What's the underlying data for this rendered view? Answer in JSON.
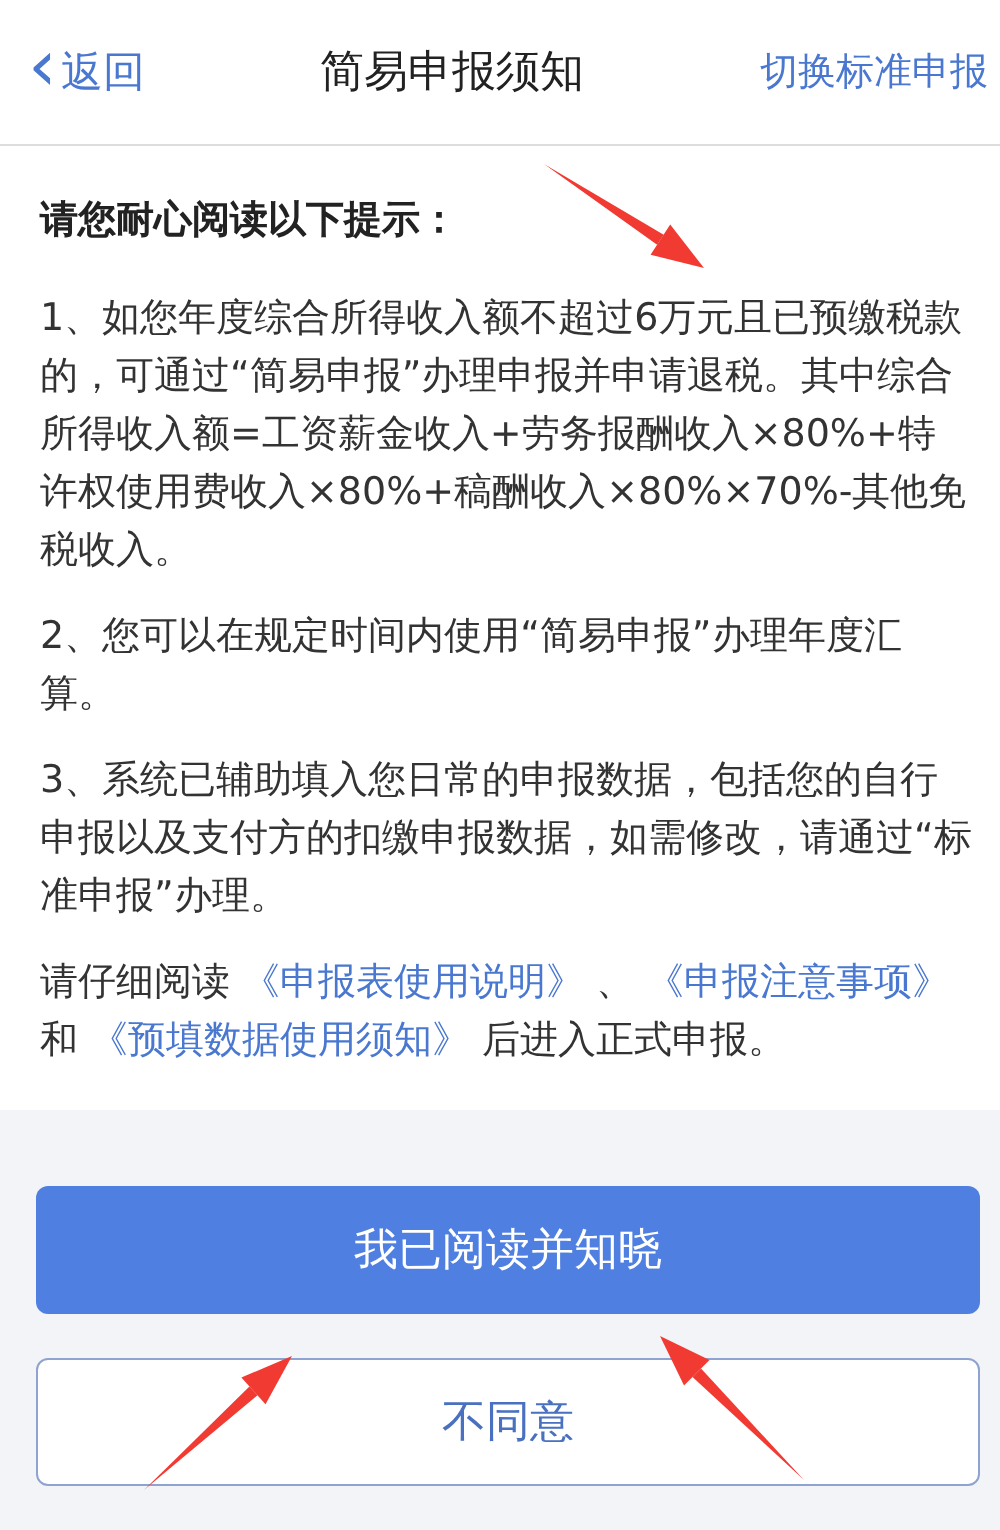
{
  "nav_bar": {
    "back": {
      "icon": "‹",
      "label": "返回"
    },
    "title": "简易申报须知",
    "action": "切换标准申报"
  },
  "notice": {
    "heading": "请您耐心阅读以下提示：",
    "paragraphs": [
      "1、如您年度综合所得收入额不超过6万元且已预缴税款的，可通过“简易申报”办理申报并申请退税。其中综合所得收入额=工资薪金收入+劳务报酬收入×80%+特许权使用费收入×80%+稿酬收入×80%×70%-其他免税收入。",
      "2、您可以在规定时间内使用“简易申报”办理年度汇算。",
      "3、系统已辅助填入您日常的申报数据，包括您的自行申报以及支付方的扣缴申报数据，如需修改，请通过“标准申报”办理。"
    ],
    "reading_note": [
      {
        "kind": "text",
        "text": "请仔细阅读 "
      },
      {
        "kind": "link",
        "text": "《申报表使用说明》"
      },
      {
        "kind": "text",
        "text": " 、 "
      },
      {
        "kind": "link",
        "text": "《申报注意事项》"
      },
      {
        "kind": "text",
        "text": " 和 "
      },
      {
        "kind": "link",
        "text": "《预填数据使用须知》"
      },
      {
        "kind": "text",
        "text": " 后进入正式申报。"
      }
    ]
  },
  "buttons": [
    {
      "kind": "primary",
      "label": "我已阅读并知晓"
    },
    {
      "kind": "secondary",
      "label": "不同意"
    }
  ]
}
